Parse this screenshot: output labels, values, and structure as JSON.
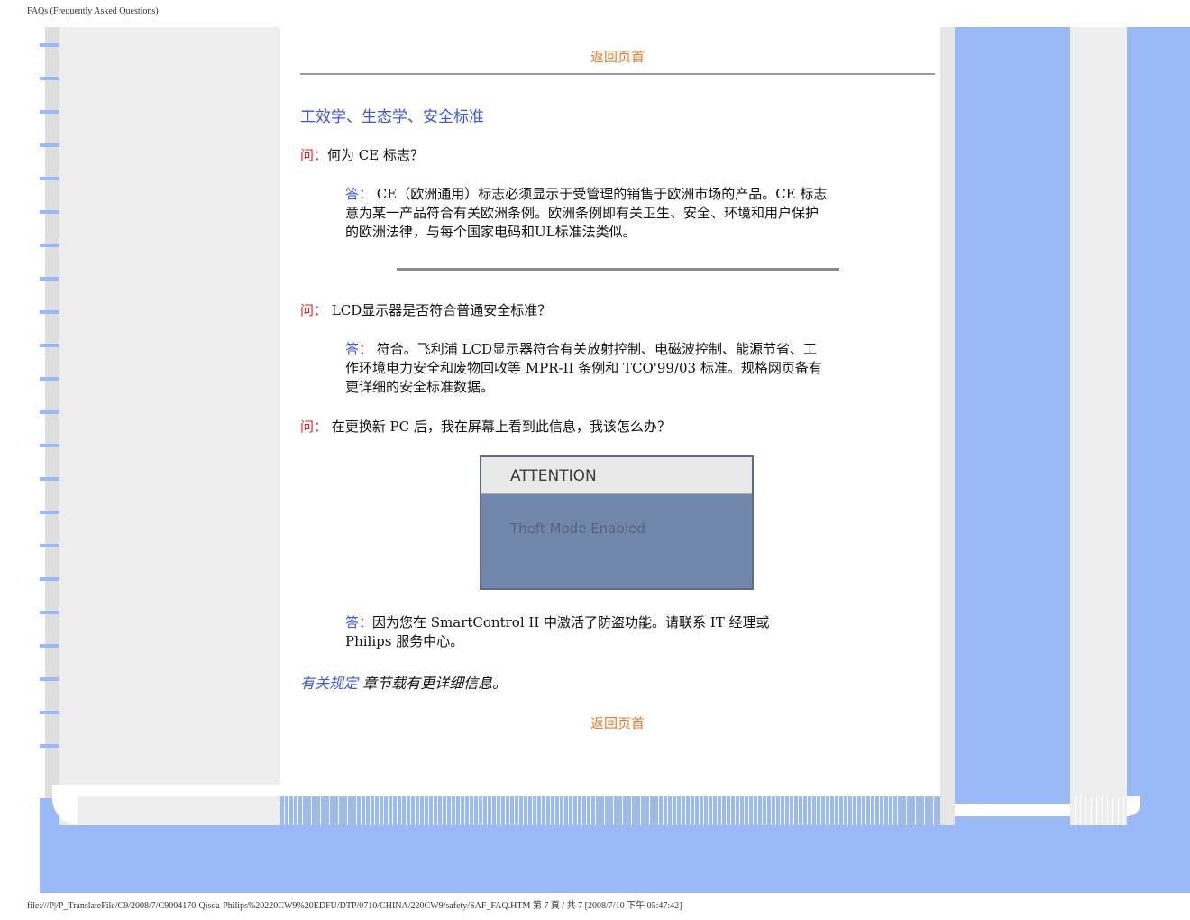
{
  "page": {
    "header_title": "FAQs (Frequently Asked Questions)",
    "footer_path": "file:///P|/P_TranslateFile/C9/2008/7/C9004170-Qisda-Philips%20220CW9%20EDFU/DTP/0710/CHINA/220CW9/safety/SAF_FAQ.HTM 第 7 頁 / 共 7  [2008/7/10 下午 05:47:42]"
  },
  "colors": {
    "frame_blue": "#9bb8f7",
    "link_orange": "#ea7a2b",
    "label_red": "#e01c1c",
    "label_blue": "#3b56e0"
  },
  "nav": {
    "back_to_top_top": "返回页首",
    "back_to_top_bottom": "返回页首"
  },
  "section_title": "工效学、生态学、安全标准",
  "qa": [
    {
      "q_label": "问：",
      "q_text": "何为 CE 标志？",
      "a_label": "答：",
      "a_lines": [
        " CE（欧洲通用）标志必须显示于受管理的销售于欧洲市场的产品。CE 标志",
        "意为某一产品符合有关欧洲条例。欧洲条例即有关卫生、安全、环境和用户保护",
        "的欧洲法律，与每个国家电码和UL标准法类似。"
      ]
    },
    {
      "q_label": "问：",
      "q_text": " LCD显示器是否符合普通安全标准？",
      "a_label": "答：",
      "a_lines": [
        " 符合。飞利浦 LCD显示器符合有关放射控制、电磁波控制、能源节省、工",
        "作环境电力安全和废物回收等 MPR-II 条例和 TCO'99/03 标准。规格网页备有",
        "更详细的安全标准数据。"
      ]
    },
    {
      "q_label": "问：",
      "q_text": " 在更换新 PC 后，我在屏幕上看到此信息，我该怎么办？",
      "a_label": "答：",
      "a_lines": [
        "因为您在 SmartControl II 中激活了防盗功能。请联系 IT 经理或",
        "Philips 服务中心。"
      ]
    }
  ],
  "attention_box": {
    "title": "ATTENTION",
    "message": "Theft Mode Enabled"
  },
  "more_info": {
    "link": "有关规定",
    "text": " 章节载有更详细信息。"
  }
}
